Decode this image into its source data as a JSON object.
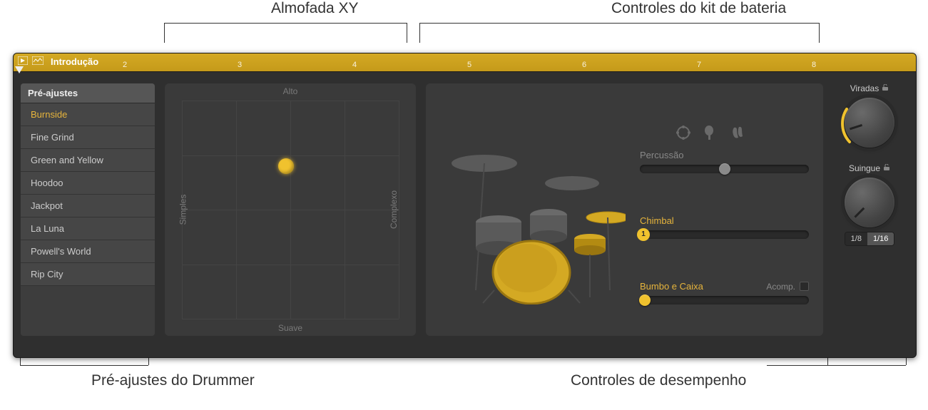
{
  "annotations": {
    "xy_pad": "Almofada XY",
    "kit_controls": "Controles do kit de bateria",
    "presets": "Pré-ajustes do Drummer",
    "performance": "Controles de desempenho"
  },
  "region": {
    "name": "Introdução",
    "bars": [
      "2",
      "3",
      "4",
      "5",
      "6",
      "7",
      "8"
    ]
  },
  "presets": {
    "header": "Pré-ajustes",
    "items": [
      {
        "label": "Burnside",
        "selected": true
      },
      {
        "label": "Fine Grind",
        "selected": false
      },
      {
        "label": "Green and Yellow",
        "selected": false
      },
      {
        "label": "Hoodoo",
        "selected": false
      },
      {
        "label": "Jackpot",
        "selected": false
      },
      {
        "label": "La Luna",
        "selected": false
      },
      {
        "label": "Powell's World",
        "selected": false
      },
      {
        "label": "Rip City",
        "selected": false
      }
    ]
  },
  "xy_pad": {
    "label_top": "Alto",
    "label_bottom": "Suave",
    "label_left": "Simples",
    "label_right": "Complexo",
    "puck_x_pct": 48,
    "puck_y_pct": 30
  },
  "kit": {
    "percussion": {
      "label": "Percussão",
      "value_pct": 50
    },
    "hihat": {
      "label": "Chimbal",
      "pip": "1"
    },
    "kicksnare": {
      "label": "Bumbo e Caixa",
      "value_pct": 0,
      "follow_label": "Acomp."
    }
  },
  "performance": {
    "fills": {
      "label": "Viradas",
      "angle_deg": -120
    },
    "swing": {
      "label": "Suingue",
      "angle_deg": -135,
      "options": [
        "1/8",
        "1/16"
      ],
      "active": "1/16"
    }
  }
}
